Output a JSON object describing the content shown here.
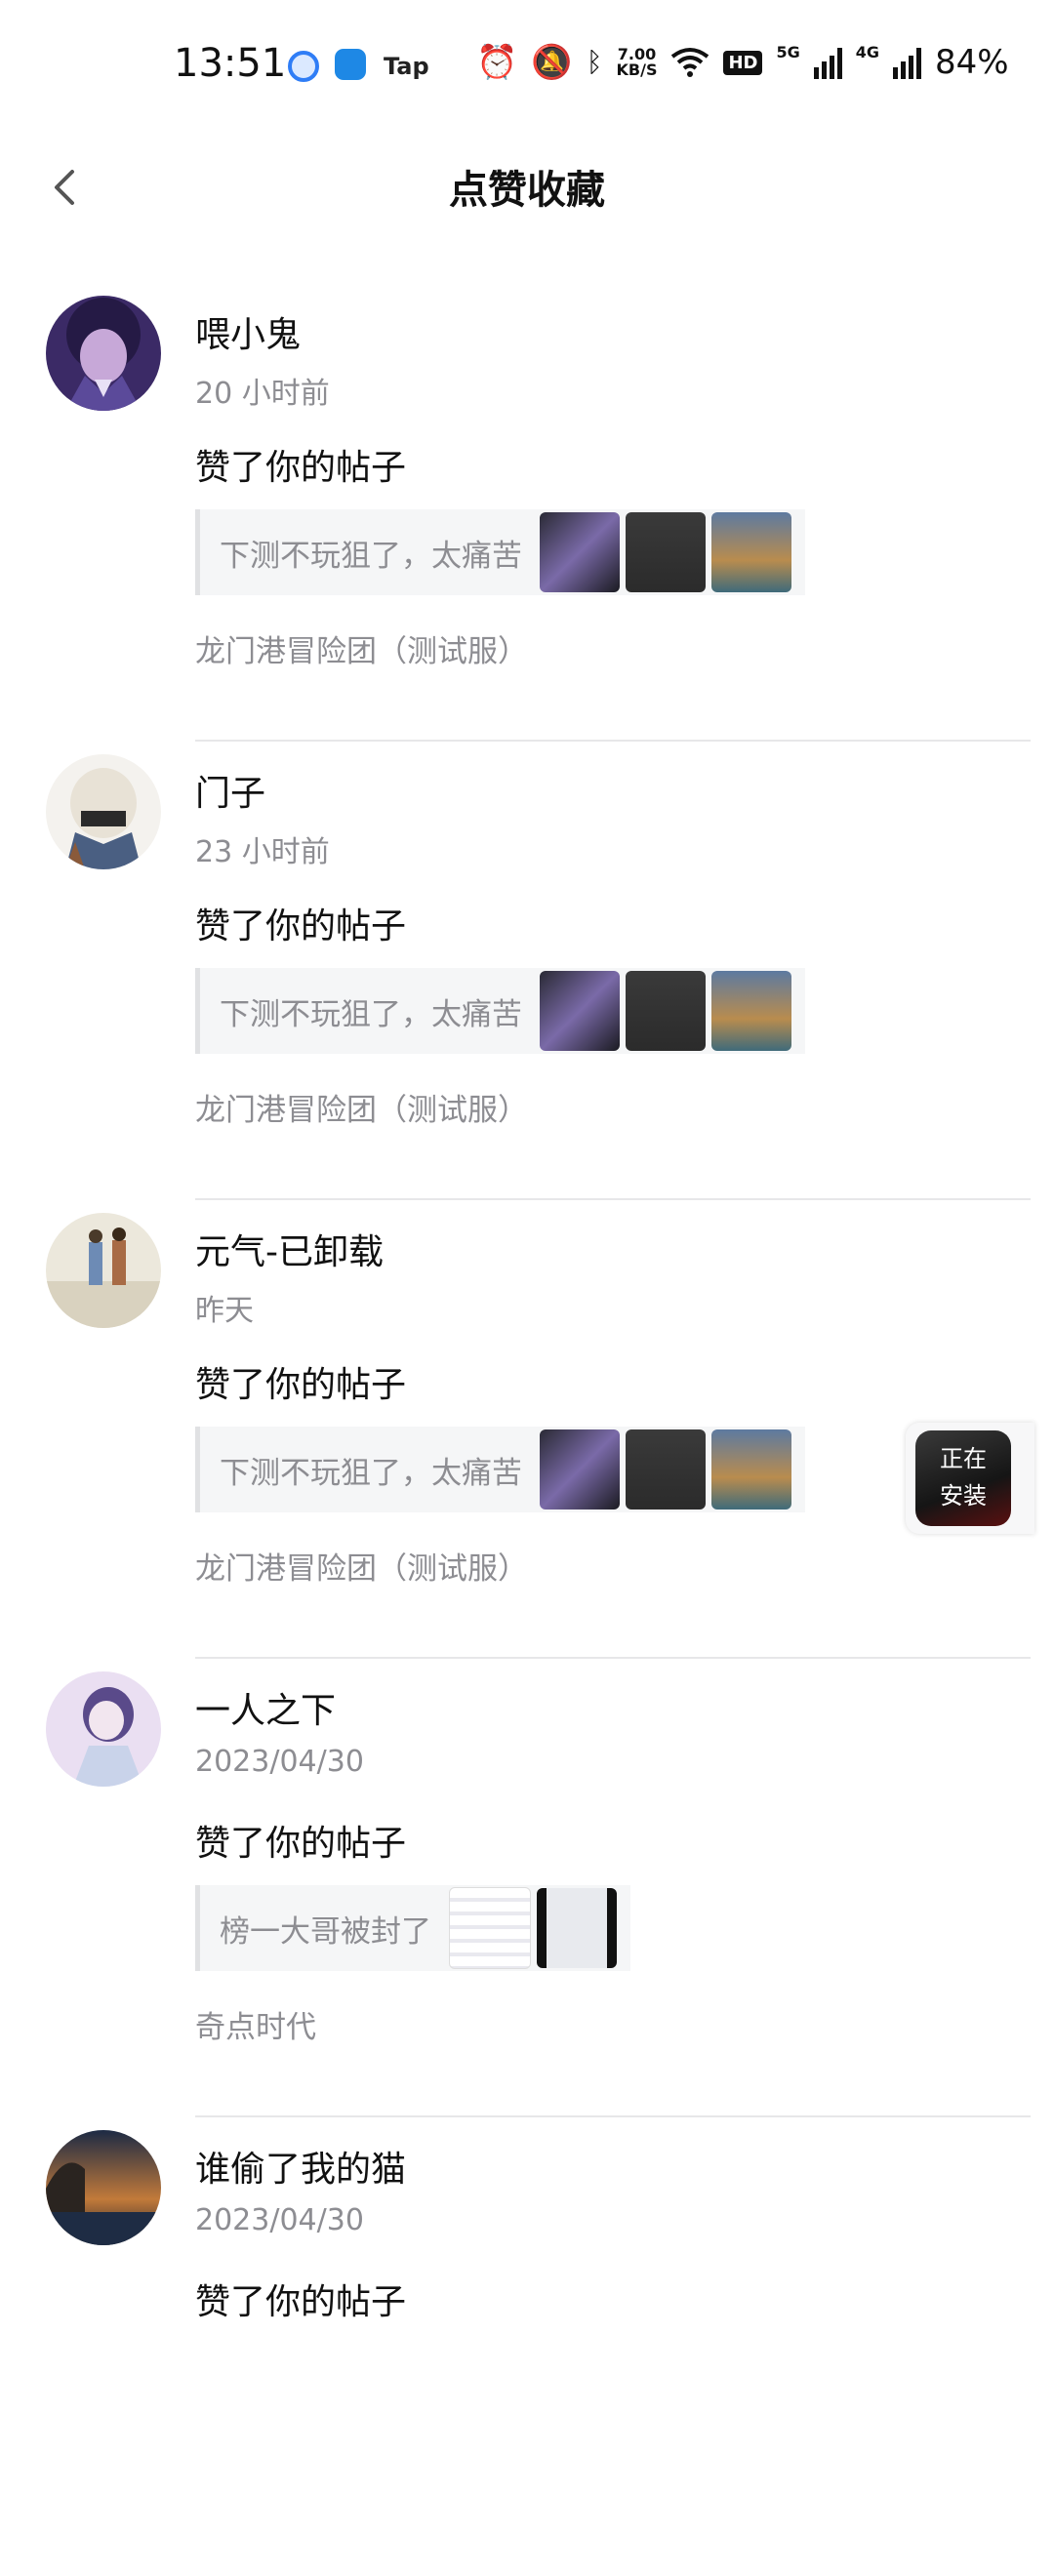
{
  "status_bar": {
    "time": "13:51",
    "tap_label": "Tap",
    "speed": "7.00",
    "speed_unit": "KB/S",
    "hd_label": "HD",
    "net1": "5G",
    "net2": "4G",
    "battery": "84%",
    "icons": [
      "app-browser-icon",
      "app-store-icon",
      "alarm-icon",
      "mute-icon",
      "bluetooth-icon",
      "wifi-icon",
      "signal-icon"
    ]
  },
  "header": {
    "title": "点赞收藏",
    "back_icon": "back-arrow-icon"
  },
  "feed": [
    {
      "name": "喂小鬼",
      "time": "20 小时前",
      "action": "赞了你的帖子",
      "quote": "下测不玩狙了，太痛苦",
      "source": "龙门港冒险团（测试服）",
      "thumbs": 3
    },
    {
      "name": "门子",
      "time": "23 小时前",
      "action": "赞了你的帖子",
      "quote": "下测不玩狙了，太痛苦",
      "source": "龙门港冒险团（测试服）",
      "thumbs": 3
    },
    {
      "name": "元气-已卸载",
      "time": "昨天",
      "action": "赞了你的帖子",
      "quote": "下测不玩狙了，太痛苦",
      "source": "龙门港冒险团（测试服）",
      "thumbs": 3
    },
    {
      "name": "一人之下",
      "time": "2023/04/30",
      "action": "赞了你的帖子",
      "quote": "榜一大哥被封了",
      "source": "奇点时代",
      "thumbs": 2
    },
    {
      "name": "谁偷了我的猫",
      "time": "2023/04/30",
      "action": "赞了你的帖子",
      "quote": "",
      "source": "",
      "thumbs": 0
    }
  ],
  "installer": {
    "line1": "正在",
    "line2": "安装"
  },
  "colors": {
    "secondary_text": "#8d8d92",
    "divider": "#e7e7e9",
    "quote_bg": "#f5f6f7"
  }
}
